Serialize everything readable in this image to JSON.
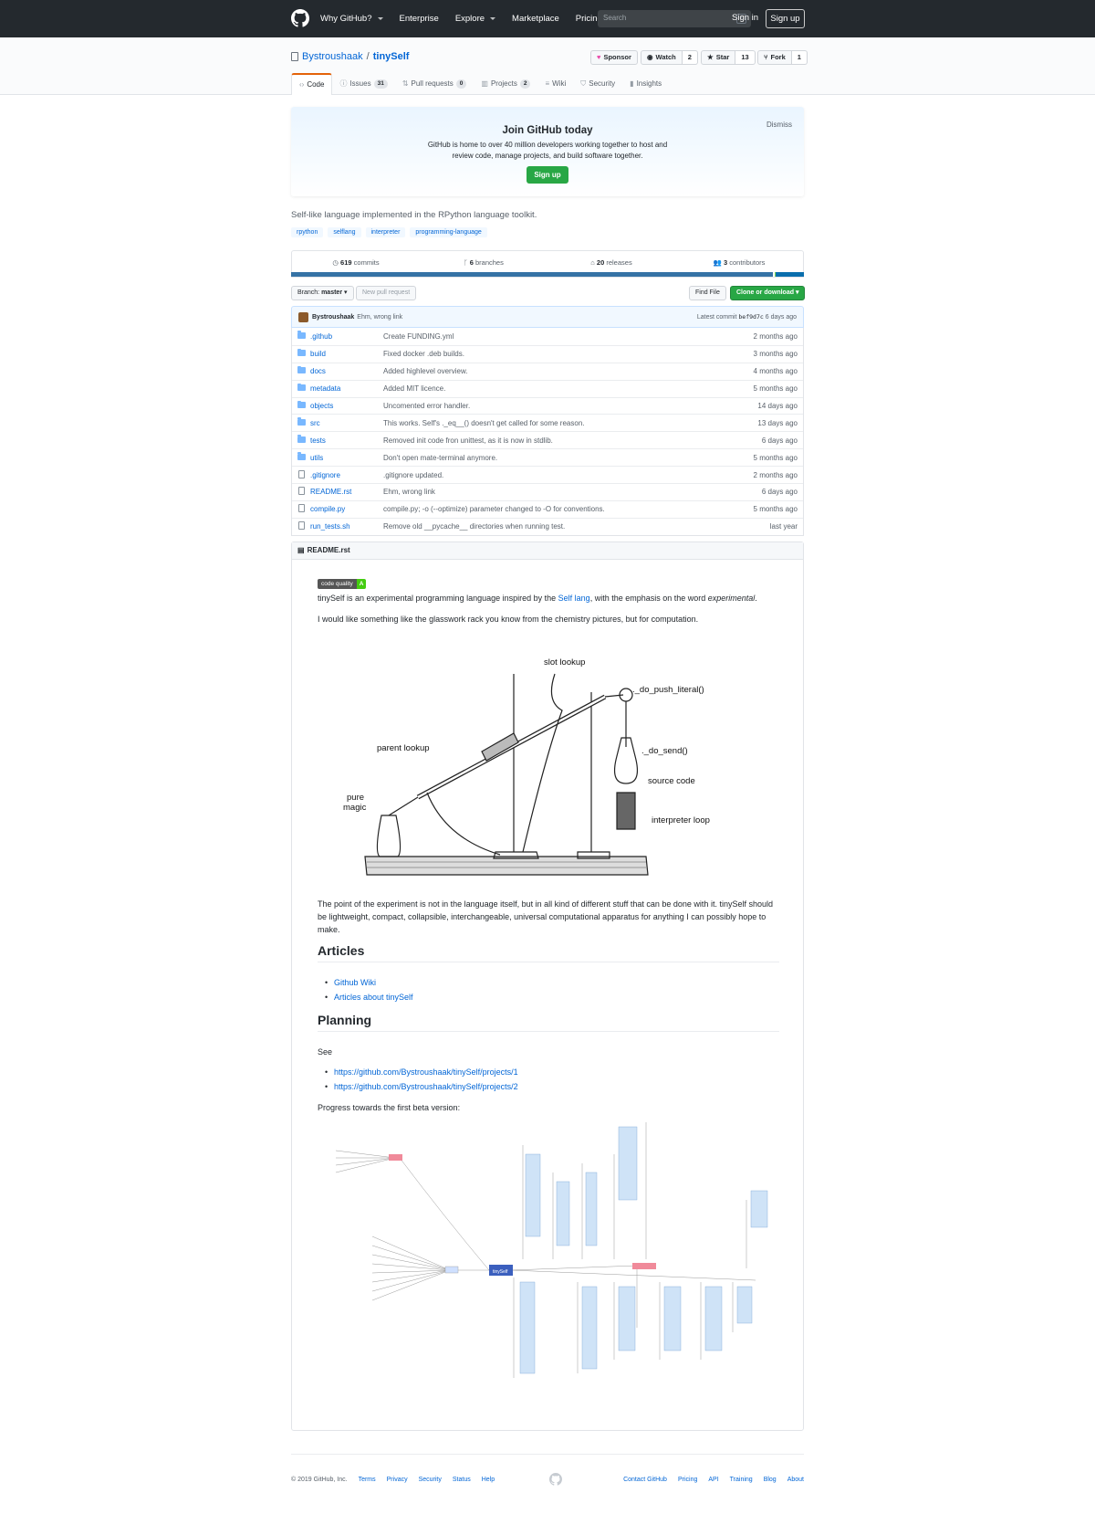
{
  "header": {
    "nav": [
      "Why GitHub?",
      "Enterprise",
      "Explore",
      "Marketplace",
      "Pricing"
    ],
    "search_placeholder": "Search",
    "search_shortcut": "/",
    "signin": "Sign in",
    "signup": "Sign up"
  },
  "repo": {
    "owner": "Bystroushaak",
    "separator": "/",
    "name": "tinySelf",
    "sponsor": "Sponsor",
    "watch": "Watch",
    "watch_count": "2",
    "star": "Star",
    "star_count": "13",
    "fork": "Fork",
    "fork_count": "1"
  },
  "tabs": [
    {
      "label": "Code",
      "count": ""
    },
    {
      "label": "Issues",
      "count": "31"
    },
    {
      "label": "Pull requests",
      "count": "0"
    },
    {
      "label": "Projects",
      "count": "2"
    },
    {
      "label": "Wiki",
      "count": ""
    },
    {
      "label": "Security",
      "count": ""
    },
    {
      "label": "Insights",
      "count": ""
    }
  ],
  "signup_prompt": {
    "title": "Join GitHub today",
    "text": "GitHub is home to over 40 million developers working together to host and review code, manage projects, and build software together.",
    "button": "Sign up",
    "dismiss": "Dismiss"
  },
  "description": "Self-like language implemented in the RPython language toolkit.",
  "topics": [
    "rpython",
    "selflang",
    "interpreter",
    "programming-language"
  ],
  "summary": {
    "commits": "619",
    "commits_label": "commits",
    "branches": "6",
    "branches_label": "branches",
    "releases": "20",
    "releases_label": "releases",
    "contributors": "3",
    "contributors_label": "contributors"
  },
  "language_bar": [
    {
      "color": "#3572A5",
      "fraction": 0.94
    },
    {
      "color": "#ffffff",
      "fraction": 0.003
    },
    {
      "color": "#89e051",
      "fraction": 0.002
    },
    {
      "color": "#0a6ead",
      "fraction": 0.055
    }
  ],
  "file_nav": {
    "branch_prefix": "Branch:",
    "branch": "master",
    "new_pr": "New pull request",
    "find_file": "Find File",
    "clone": "Clone or download"
  },
  "latest_commit": {
    "author": "Bystroushaak",
    "message": "Ehm, wrong link",
    "label": "Latest commit",
    "sha": "bef9d7c",
    "age": "6 days ago"
  },
  "files": [
    {
      "type": "dir",
      "name": ".github",
      "message": "Create FUNDING.yml",
      "age": "2 months ago"
    },
    {
      "type": "dir",
      "name": "build",
      "message": "Fixed docker .deb builds.",
      "age": "3 months ago"
    },
    {
      "type": "dir",
      "name": "docs",
      "message": "Added highlevel overview.",
      "age": "4 months ago"
    },
    {
      "type": "dir",
      "name": "metadata",
      "message": "Added MIT licence.",
      "age": "5 months ago"
    },
    {
      "type": "dir",
      "name": "objects",
      "message": "Uncomented error handler.",
      "age": "14 days ago"
    },
    {
      "type": "dir",
      "name": "src",
      "message": "This works. Self's ._eq__() doesn't get called for some reason.",
      "age": "13 days ago"
    },
    {
      "type": "dir",
      "name": "tests",
      "message": "Removed init code fron unittest, as it is now in stdlib.",
      "age": "6 days ago"
    },
    {
      "type": "dir",
      "name": "utils",
      "message": "Don't open mate-terminal anymore.",
      "age": "5 months ago"
    },
    {
      "type": "file",
      "name": ".gitignore",
      "message": ".gitignore updated.",
      "age": "2 months ago"
    },
    {
      "type": "file",
      "name": "README.rst",
      "message": "Ehm, wrong link",
      "age": "6 days ago"
    },
    {
      "type": "file",
      "name": "compile.py",
      "message": "compile.py; -o (--optimize) parameter changed to -O for conventions.",
      "age": "5 months ago"
    },
    {
      "type": "file",
      "name": "run_tests.sh",
      "message": "Remove old __pycache__ directories when running test.",
      "age": "last year"
    }
  ],
  "readme": {
    "filename": "README.rst",
    "badge_left": "code quality",
    "badge_right": "A",
    "p1_a": "tinySelf is an experimental programming language inspired by the ",
    "p1_link": "Self lang",
    "p1_b": ", with the emphasis on the word ",
    "p1_em": "experimental",
    "p1_c": ".",
    "p2": "I would like something like the glasswork rack you know from the chemistry pictures, but for computation.",
    "illustration_labels": {
      "slot": "slot lookup",
      "push": "._do_push_literal()",
      "parent": "parent lookup",
      "send": "._do_send()",
      "source": "source code",
      "magic1": "pure",
      "magic2": "magic",
      "loop": "interpreter loop"
    },
    "p3": "The point of the experiment is not in the language itself, but in all kind of different stuff that can be done with it. tinySelf should be lightweight, compact, collapsible, interchangeable, universal computational apparatus for anything I can possibly hope to make.",
    "h_articles": "Articles",
    "articles": [
      "Github Wiki",
      "Articles about tinySelf"
    ],
    "h_planning": "Planning",
    "see": "See",
    "planning_links": [
      "https://github.com/Bystroushaak/tinySelf/projects/1",
      "https://github.com/Bystroushaak/tinySelf/projects/2"
    ],
    "progress": "Progress towards the first beta version:",
    "mindmap_center": "tinySelf"
  },
  "footer": {
    "left": [
      "© 2019 GitHub, Inc.",
      "Terms",
      "Privacy",
      "Security",
      "Status",
      "Help"
    ],
    "right": [
      "Contact GitHub",
      "Pricing",
      "API",
      "Training",
      "Blog",
      "About"
    ]
  }
}
